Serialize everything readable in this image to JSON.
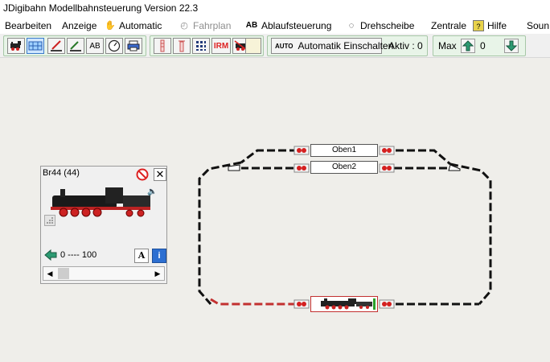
{
  "window": {
    "title": "JDigibahn Modellbahnsteuerung Version 22.3"
  },
  "menu": {
    "bearbeiten": "Bearbeiten",
    "anzeige": "Anzeige",
    "automatic": "Automatic",
    "fahrplan": "Fahrplan",
    "ablaufsteuerung": "Ablaufsteuerung",
    "drehscheibe": "Drehscheibe",
    "zentrale": "Zentrale",
    "hilfe": "Hilfe",
    "sound": "Soun"
  },
  "toolbar": {
    "ab_label": "AB",
    "irm_label": "IRM",
    "auto_icon": "AUTO",
    "automatik_label": "Automatik Einschalten",
    "aktiv_label": "Aktiv : 0",
    "max_label": "Max",
    "max_value": "0"
  },
  "loco": {
    "name": "Br44 (44)",
    "range": "0 ---- 100",
    "a_label": "A",
    "info_label": "i"
  },
  "blocks": {
    "top1": "Oben1",
    "top2": "Oben2"
  },
  "colors": {
    "toolbar_group_bg": "#e8f4e8",
    "track": "#111111",
    "signal_red": "#d42020",
    "occupied_track": "#c23030"
  }
}
